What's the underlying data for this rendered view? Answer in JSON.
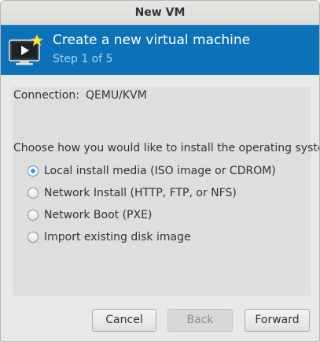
{
  "window": {
    "title": "New VM"
  },
  "banner": {
    "title": "Create a new virtual machine",
    "step": "Step 1 of 5",
    "icon": "vm-monitor-star-icon",
    "background": "#0b72ba"
  },
  "connection": {
    "label": "Connection:",
    "value": "QEMU/KVM"
  },
  "install": {
    "question": "Choose how you would like to install the operating system",
    "options": [
      {
        "label": "Local install media (ISO image or CDROM)",
        "selected": true
      },
      {
        "label": "Network Install (HTTP, FTP, or NFS)",
        "selected": false
      },
      {
        "label": "Network Boot (PXE)",
        "selected": false
      },
      {
        "label": "Import existing disk image",
        "selected": false
      }
    ]
  },
  "buttons": {
    "cancel": "Cancel",
    "back": "Back",
    "back_enabled": false,
    "forward": "Forward"
  }
}
